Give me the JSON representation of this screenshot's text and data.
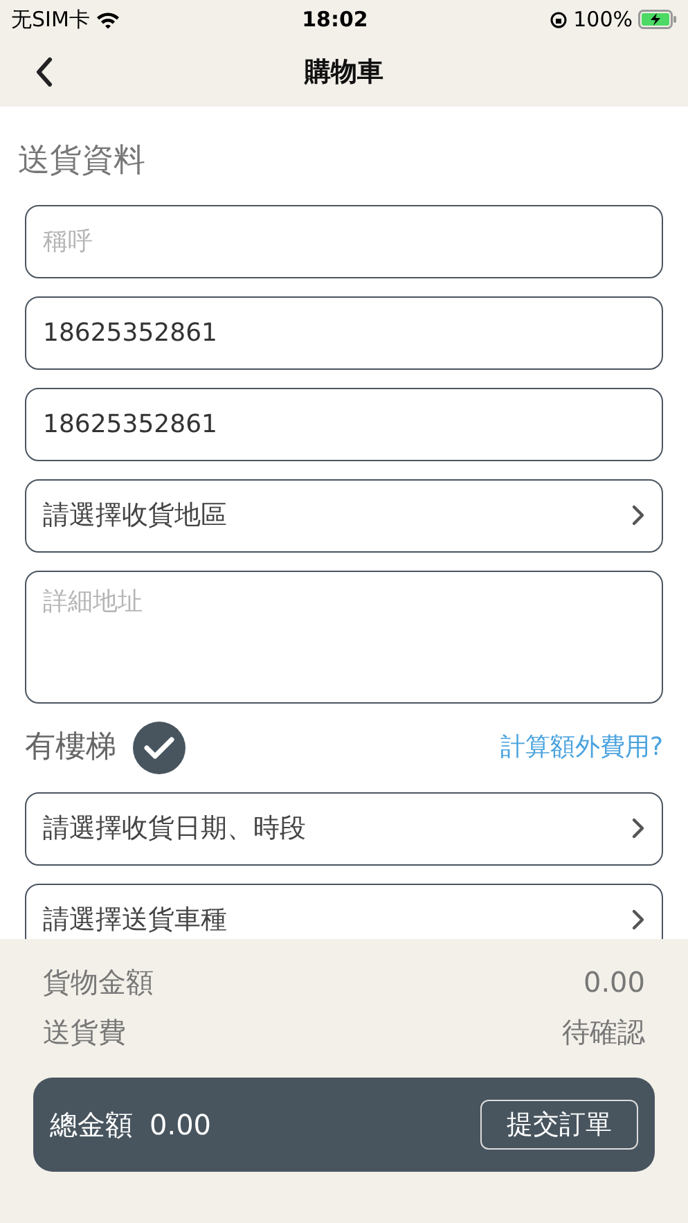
{
  "status_bar": {
    "carrier": "无SIM卡",
    "time": "18:02",
    "battery": "100%",
    "charging": true
  },
  "nav": {
    "title": "購物車"
  },
  "section_title": "送貨資料",
  "fields": [
    {
      "kind": "input",
      "placeholder": "稱呼"
    },
    {
      "kind": "input",
      "value": "18625352861"
    },
    {
      "kind": "input",
      "value": "18625352861"
    },
    {
      "kind": "select",
      "label": "請選擇收貨地區"
    },
    {
      "kind": "textarea",
      "placeholder": "詳細地址"
    },
    {
      "kind": "checkbox",
      "label": "有樓梯",
      "checked": true,
      "link": "計算額外費用?"
    },
    {
      "kind": "select",
      "label": "請選擇收貨日期、時段"
    },
    {
      "kind": "select",
      "label": "請選擇送貨車種"
    }
  ],
  "summary": [
    {
      "label": "貨物金額",
      "value": "0.00"
    },
    {
      "label": "送貨費",
      "value": "待確認"
    }
  ],
  "total": {
    "label": "總金額",
    "value": "0.00",
    "button": "提交訂單"
  }
}
